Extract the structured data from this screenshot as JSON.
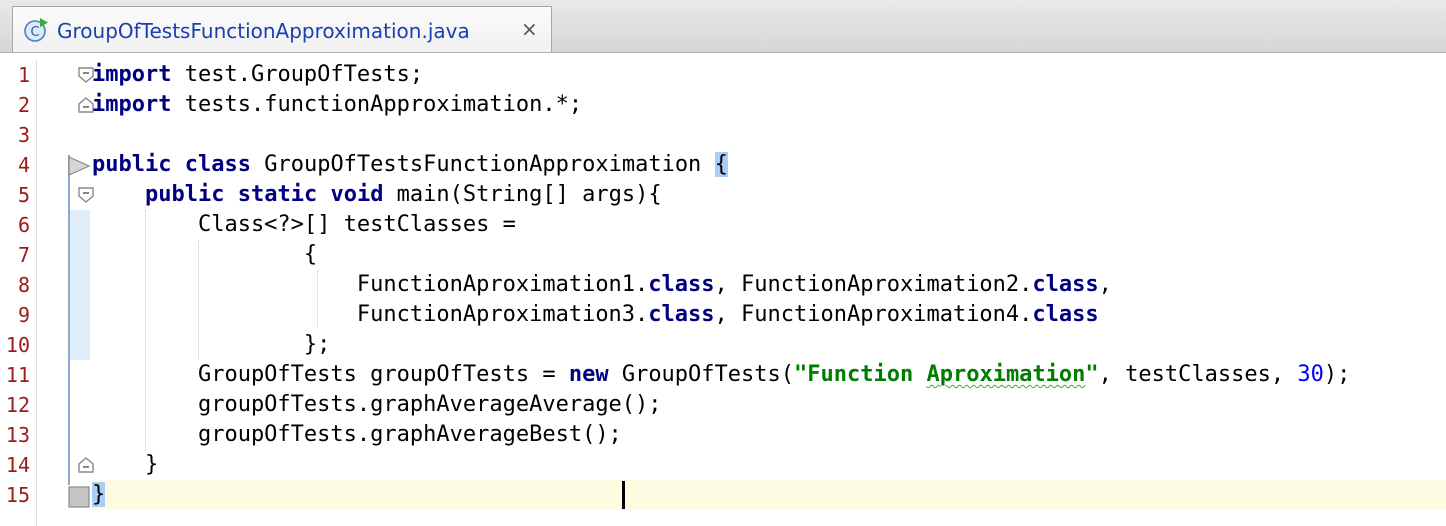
{
  "tab": {
    "title": "GroupOfTestsFunctionApproximation.java",
    "close_glyph": "×",
    "icon": "java-class-runnable-icon",
    "icon_letter": "C"
  },
  "editor": {
    "line_numbers": [
      "1",
      "2",
      "3",
      "4",
      "5",
      "6",
      "7",
      "8",
      "9",
      "10",
      "11",
      "12",
      "13",
      "14",
      "15"
    ],
    "current_line": 15,
    "lines": [
      [
        {
          "t": "import",
          "c": "kw"
        },
        {
          "t": " test.GroupOfTests;"
        }
      ],
      [
        {
          "t": "import",
          "c": "kw"
        },
        {
          "t": " tests.functionApproximation.*;"
        }
      ],
      [],
      [
        {
          "t": "public",
          "c": "kw"
        },
        {
          "t": " "
        },
        {
          "t": "class",
          "c": "kw"
        },
        {
          "t": " GroupOfTestsFunctionApproximation "
        },
        {
          "t": "{",
          "c": "brace-hl"
        }
      ],
      [
        {
          "t": "    "
        },
        {
          "t": "public",
          "c": "kw"
        },
        {
          "t": " "
        },
        {
          "t": "static",
          "c": "kw"
        },
        {
          "t": " "
        },
        {
          "t": "void",
          "c": "kw"
        },
        {
          "t": " main(String[] args){"
        }
      ],
      [
        {
          "t": "        Class<?>[] testClasses ="
        }
      ],
      [
        {
          "t": "                {"
        }
      ],
      [
        {
          "t": "                    FunctionAproximation1."
        },
        {
          "t": "class",
          "c": "kw"
        },
        {
          "t": ", FunctionAproximation2."
        },
        {
          "t": "class",
          "c": "kw"
        },
        {
          "t": ","
        }
      ],
      [
        {
          "t": "                    FunctionAproximation3."
        },
        {
          "t": "class",
          "c": "kw"
        },
        {
          "t": ", FunctionAproximation4."
        },
        {
          "t": "class",
          "c": "kw"
        }
      ],
      [
        {
          "t": "                };"
        }
      ],
      [
        {
          "t": "        GroupOfTests groupOfTests = "
        },
        {
          "t": "new",
          "c": "kw"
        },
        {
          "t": " GroupOfTests("
        },
        {
          "t": "\"Function ",
          "c": "str"
        },
        {
          "t": "Aproximation",
          "c": "str squiggle"
        },
        {
          "t": "\"",
          "c": "str"
        },
        {
          "t": ", testClasses, "
        },
        {
          "t": "30",
          "c": "num"
        },
        {
          "t": ");"
        }
      ],
      [
        {
          "t": "        groupOfTests.graphAverageAverage();"
        }
      ],
      [
        {
          "t": "        groupOfTests.graphAverageBest();"
        }
      ],
      [
        {
          "t": "    }"
        }
      ],
      [
        {
          "t": "}",
          "c": "brace-hl"
        }
      ]
    ]
  },
  "colors": {
    "keyword": "#000080",
    "string": "#007d00",
    "number": "#0000ff",
    "line_number": "#9b1b1b",
    "current_line_bg": "#fdfce2",
    "brace_highlight": "#a8cef7",
    "tab_title": "#1a3fb0"
  }
}
